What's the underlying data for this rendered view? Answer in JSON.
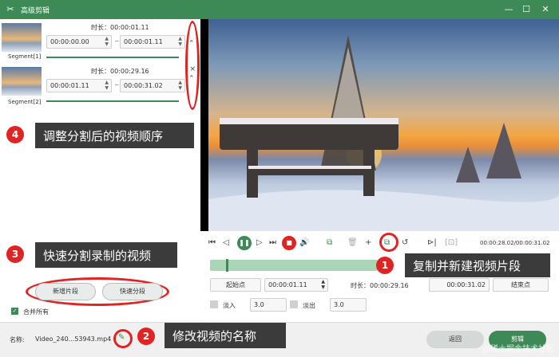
{
  "window": {
    "title": "高级剪辑"
  },
  "segments": [
    {
      "label": "Segment[1]",
      "duration": "时长：00:00:01.11",
      "start": "00:00:00.00",
      "end": "00:00:01.11",
      "delete": "×"
    },
    {
      "label": "Segment[2]",
      "duration": "时长：00:00:29.16",
      "start": "00:00:01.11",
      "end": "00:00:31.02",
      "delete": "×"
    }
  ],
  "left_actions": {
    "new_segment": "新增片段",
    "quick_split": "快速分段",
    "merge_all": "合并所有"
  },
  "annotations": {
    "n1": "1",
    "t1": "复制并新建视频片段",
    "n2": "2",
    "t2": "修改视频的名称",
    "n3": "3",
    "t3": "快速分割录制的视频",
    "n4": "4",
    "t4": "调整分割后的视频顺序"
  },
  "player": {
    "time": "00:00:28.02/00:00:31.02"
  },
  "trim": {
    "start_label": "起始点",
    "start_value": "00:00:01.11",
    "duration": "时长：00:00:29.16",
    "end_value": "00:00:31.02",
    "end_label": "结束点"
  },
  "fade": {
    "fade_in_label": "淡入",
    "fade_in_value": "3.0",
    "fade_out_label": "淡出",
    "fade_out_value": "3.0"
  },
  "bottom": {
    "name_label": "名称:",
    "name_value": "Video_240...53943.mp4",
    "back_button": "返回",
    "edit_button": "剪辑"
  },
  "watermark": "@稀土掘金技术社区",
  "colors": {
    "brand": "#3d8a56",
    "annotation": "#e02323",
    "callout": "#3b3b3b"
  }
}
